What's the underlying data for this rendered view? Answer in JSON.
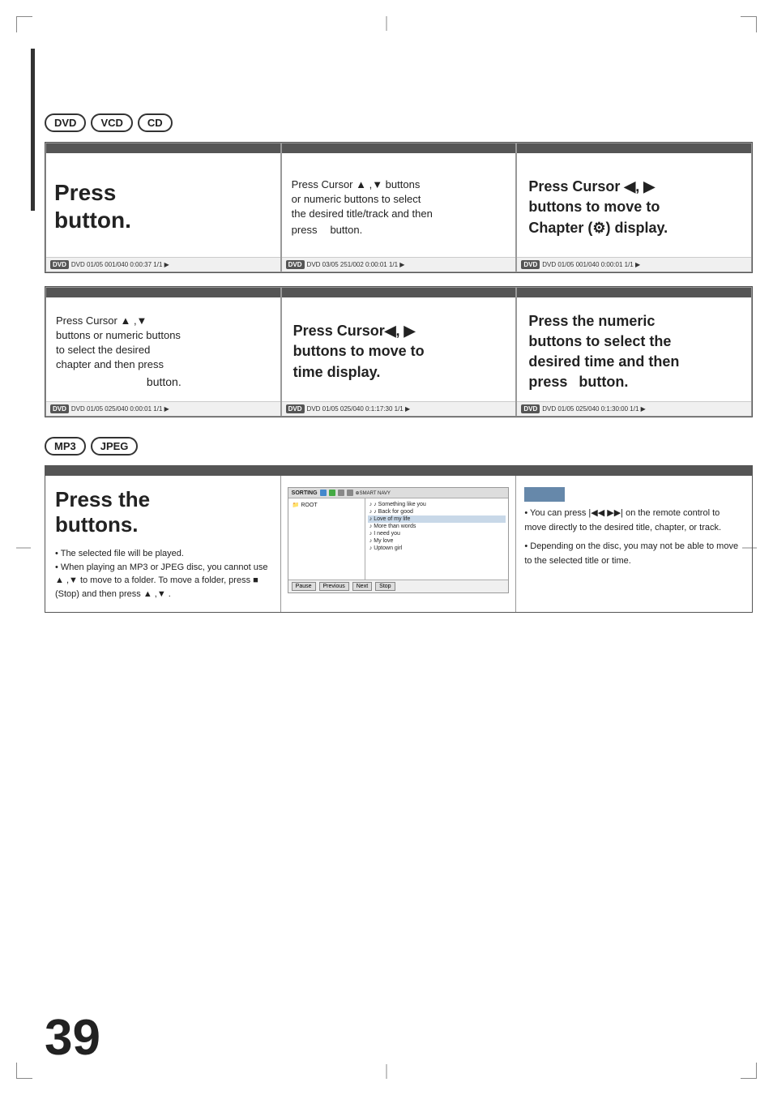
{
  "page": {
    "number": "39",
    "badges_row1": [
      "DVD",
      "VCD",
      "CD"
    ],
    "badges_mp3": [
      "MP3",
      "JPEG"
    ]
  },
  "section1": {
    "cell1": {
      "big_text_line1": "Press",
      "big_text_line2": "button.",
      "status": "DVD  01/05  001/040  0:00:37  1/1  ▶"
    },
    "cell2": {
      "line1": "Press Cursor ▲ ,▼ buttons",
      "line2": "or numeric buttons to select",
      "line3": "the desired title/track and then",
      "line4": "press",
      "line5": "button.",
      "status": "DVD  03/05  251/002  0:00:01  1/1  ▶"
    },
    "cell3": {
      "line1": "Press Cursor ◀, ▶",
      "line2": "buttons to move to",
      "line3": "Chapter (⚙) display.",
      "status": "DVD  01/05  001/040  0:00:01  1/1  ▶"
    }
  },
  "section2": {
    "cell1": {
      "line1": "Press Cursor ▲ ,▼",
      "line2": "buttons or numeric buttons",
      "line3": "to select the desired",
      "line4": "chapter and then press",
      "line5": "button.",
      "status": "DVD  01/05  025/040  0:00:01  1/1  ▶"
    },
    "cell2": {
      "line1": "Press Cursor◀, ▶",
      "line2": "buttons to move to",
      "line3": "time display.",
      "status": "DVD  01/05  025/040  0:1:17:30  1/1  ▶"
    },
    "cell3": {
      "line1": "Press the numeric",
      "line2": "buttons to select the",
      "line3": "desired time and then",
      "line4": "press",
      "line5": "button.",
      "status": "DVD  01/05  025/040  0:1:30:00  1/1  ▶"
    }
  },
  "mp3_section": {
    "left": {
      "big_text": "Press the\nbuttons.",
      "bullets": [
        "The selected file will be played.",
        "When playing an MP3 or JPEG disc, you cannot use ▲ ,▼  to move to a folder. To move a folder, press ■ (Stop) and then press ▲ ,▼ ."
      ]
    },
    "middle": {
      "toolbar_label": "SORTING",
      "toolbar_icons": "🔵 🔵 📋 ⊕SMART NAVY",
      "root_label": "ROOT",
      "files": [
        "♪ Something like you",
        "♪ Back for good",
        "♪ Love of my life",
        "♪ More than words",
        "♪ I need you",
        "♪ My love",
        "♪ Uptown girl"
      ],
      "footer_buttons": [
        "Pause",
        "Previous",
        "Next",
        "Stop"
      ]
    },
    "right": {
      "bullets": [
        "You can press |◀◀ ▶▶| on the remote control to move directly to the desired title, chapter, or track.",
        "Depending on the disc, you may not be able to move to the selected title or time."
      ]
    }
  }
}
